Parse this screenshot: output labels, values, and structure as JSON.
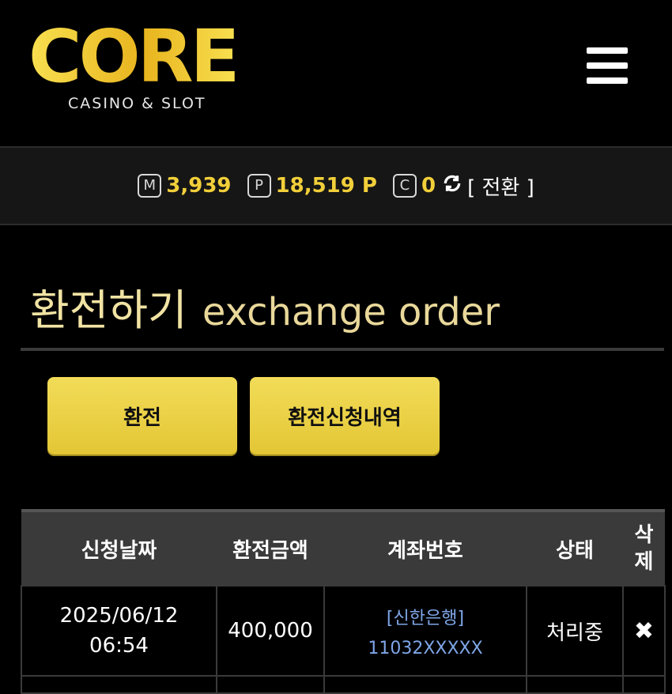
{
  "header": {
    "logo_text": "CORE",
    "logo_subtitle": "CASINO & SLOT"
  },
  "balance": {
    "money_icon": "M",
    "money_value": "3,939",
    "point_icon": "P",
    "point_value": "18,519 P",
    "coupon_icon": "C",
    "coupon_value": "0",
    "refresh_icon": "refresh-icon",
    "convert_label": "[ 전환 ]"
  },
  "page": {
    "title_ko": "환전하기",
    "title_en": "exchange order"
  },
  "buttons": {
    "exchange": "환전",
    "history": "환전신청내역"
  },
  "table": {
    "headers": [
      "신청날짜",
      "환전금액",
      "계좌번호",
      "상태",
      "삭\n제"
    ],
    "rows": [
      {
        "date": "2025/06/12",
        "time": "06:54",
        "amount": "400,000",
        "bank": "[신한은행]",
        "account": "11032XXXXX",
        "status": "처리중",
        "delete_icon": "✖"
      }
    ]
  },
  "colors": {
    "accent": "#f2cf3a",
    "button": "#e8ca3c",
    "link": "#7fa6e8"
  }
}
